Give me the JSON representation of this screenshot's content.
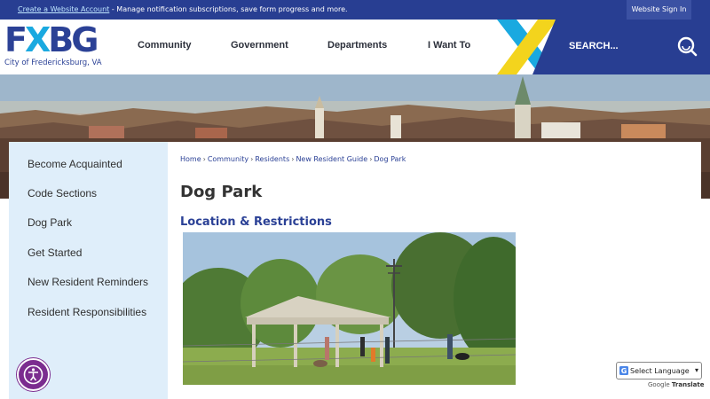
{
  "topbar": {
    "create_link": "Create a Website Account",
    "message": " - Manage notification subscriptions, save form progress and more.",
    "signin_label": "Website Sign In"
  },
  "logo": {
    "wordmark_left": "F",
    "wordmark_x": "X",
    "wordmark_right": "BG",
    "subtitle": "City of Fredericksburg, VA"
  },
  "nav": {
    "items": [
      {
        "label": "Community"
      },
      {
        "label": "Government"
      },
      {
        "label": "Departments"
      },
      {
        "label": "I Want To"
      }
    ],
    "search_label": "SEARCH..."
  },
  "sidebar": {
    "items": [
      {
        "label": "Become Acquainted"
      },
      {
        "label": "Code Sections"
      },
      {
        "label": "Dog Park"
      },
      {
        "label": "Get Started"
      },
      {
        "label": "New Resident Reminders"
      },
      {
        "label": "Resident Responsibilities"
      }
    ]
  },
  "breadcrumb": [
    "Home",
    "Community",
    "Residents",
    "New Resident Guide",
    "Dog Park"
  ],
  "page": {
    "title": "Dog Park",
    "section_title": "Location & Restrictions"
  },
  "translate": {
    "select_label": "Select Language",
    "powered_by": "Google",
    "translate_label": "Translate"
  },
  "colors": {
    "brand_blue": "#283e92",
    "accent_yellow": "#f3d41d",
    "accent_cyan": "#1aa9e0",
    "sidebar_bg": "#dfeefa",
    "accessibility_purple": "#7b2c8f"
  },
  "icons": {
    "search": "search-icon",
    "accessibility": "accessibility-icon",
    "google": "google-g-icon"
  }
}
